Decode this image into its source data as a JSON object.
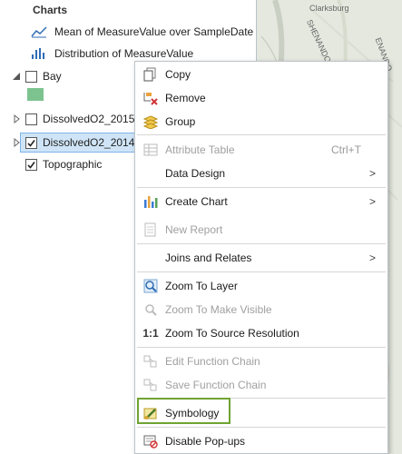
{
  "toc": {
    "charts_heading": "Charts",
    "charts": [
      {
        "label": "Mean of MeasureValue over SampleDate",
        "icon": "line-chart-icon"
      },
      {
        "label": "Distribution of MeasureValue",
        "icon": "histogram-icon"
      }
    ],
    "layers": [
      {
        "label": "Bay",
        "checked": false,
        "expanded": true
      },
      {
        "label": "DissolvedO2_2015",
        "checked": false,
        "expanded": false
      },
      {
        "label": "DissolvedO2_2014",
        "checked": true,
        "expanded": false,
        "selected": true
      },
      {
        "label": "Topographic",
        "checked": true
      }
    ],
    "bay_swatch_color": "#7cc38f"
  },
  "map": {
    "labels": [
      "Clarksburg",
      "SHENANDOAH",
      "ENANDO"
    ]
  },
  "context_menu": {
    "items": [
      {
        "label": "Copy",
        "icon": "copy-icon"
      },
      {
        "label": "Remove",
        "icon": "remove-icon"
      },
      {
        "label": "Group",
        "icon": "group-layers-icon"
      },
      {
        "label": "Attribute Table",
        "icon": "table-icon",
        "shortcut": "Ctrl+T",
        "disabled": true
      },
      {
        "label": "Data Design",
        "submenu": true
      },
      {
        "label": "Create Chart",
        "icon": "bar-chart-icon",
        "submenu": true
      },
      {
        "label": "New Report",
        "icon": "report-icon",
        "disabled": true
      },
      {
        "label": "Joins and Relates",
        "submenu": true
      },
      {
        "label": "Zoom To Layer",
        "icon": "zoom-layer-icon"
      },
      {
        "label": "Zoom To Make Visible",
        "icon": "zoom-visible-icon",
        "disabled": true
      },
      {
        "label": "Zoom To Source Resolution",
        "icon": "one-to-one-icon"
      },
      {
        "label": "Edit Function Chain",
        "icon": "edit-function-icon",
        "disabled": true
      },
      {
        "label": "Save Function Chain",
        "icon": "save-function-icon",
        "disabled": true
      },
      {
        "label": "Symbology",
        "icon": "symbology-icon",
        "highlighted": true
      },
      {
        "label": "Disable Pop-ups",
        "icon": "disable-popup-icon"
      }
    ],
    "one_to_one_glyph": "1:1",
    "arrow_glyph": ">",
    "highlight_color": "#6fa332"
  }
}
